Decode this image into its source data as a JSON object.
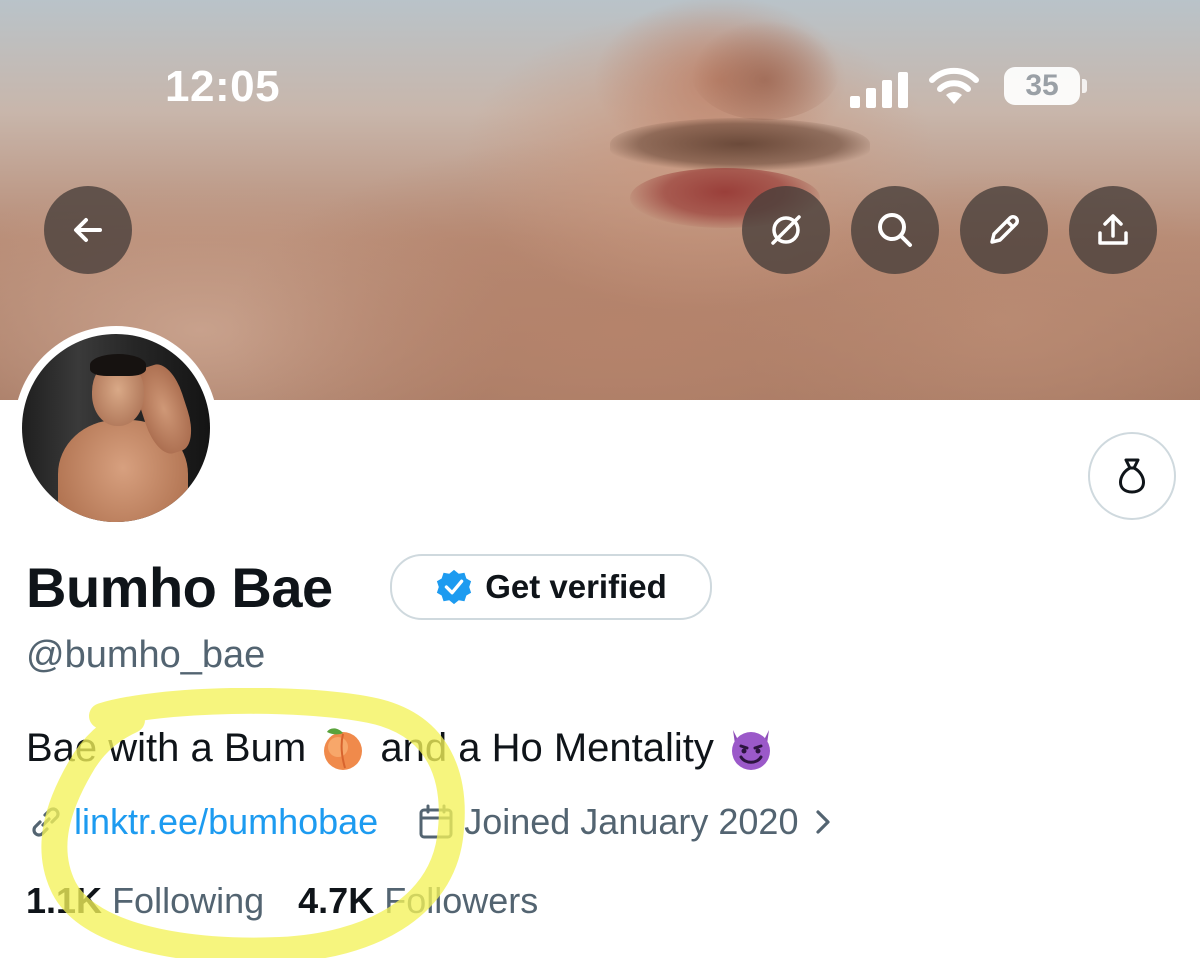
{
  "status_bar": {
    "time": "12:05",
    "battery": "35"
  },
  "header": {
    "buttons": [
      "back-icon",
      "grok-icon",
      "search-icon",
      "edit-icon",
      "share-icon"
    ]
  },
  "profile": {
    "name": "Bumho Bae",
    "verify_label": "Get verified",
    "handle": "@bumho_bae",
    "bio_part1": "Bae with a Bum ",
    "bio_part2": " and a Ho Mentality ",
    "link": "linktr.ee/bumhobae",
    "joined": "Joined January 2020",
    "following_count": "1.1K",
    "following_label": "Following",
    "followers_count": "4.7K",
    "followers_label": "Followers"
  },
  "colors": {
    "accent": "#1d9bf0",
    "highlight": "#f4f25a",
    "text_secondary": "#536471"
  }
}
